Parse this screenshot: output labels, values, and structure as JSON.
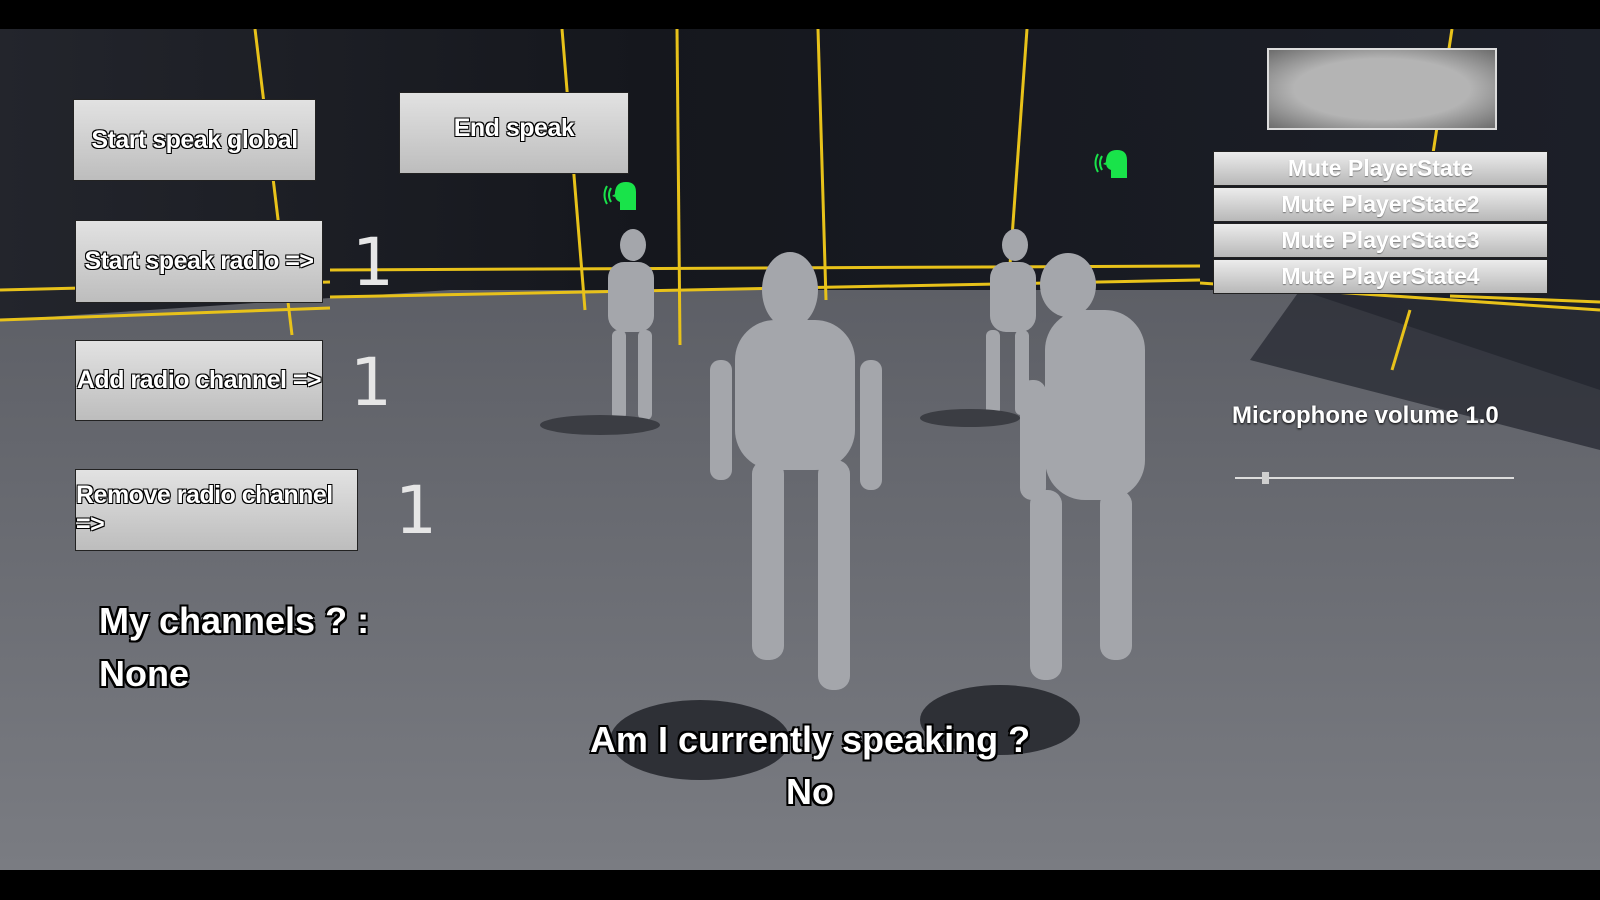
{
  "buttons": {
    "start_speak_global": "Start speak global",
    "end_speak": "End speak",
    "start_speak_radio": "Start speak radio =>",
    "add_radio_channel": "Add radio channel =>",
    "remove_radio_channel": "Remove radio channel =>"
  },
  "channel_inputs": {
    "start_speak_radio": "1",
    "add_radio_channel": "1",
    "remove_radio_channel": "1"
  },
  "my_channels": {
    "label": "My channels ? :",
    "value": "None"
  },
  "speaking_status": {
    "label": "Am I currently speaking ?",
    "value": "No"
  },
  "mute_buttons": [
    "Mute PlayerState",
    "Mute PlayerState2",
    "Mute PlayerState3",
    "Mute PlayerState4"
  ],
  "microphone": {
    "label": "Microphone volume 1.0",
    "slider_value": 0.1
  },
  "colors": {
    "speaker_icon": "#19e34a",
    "grid_lines": "#e8c21a",
    "wall": "#1a1c24",
    "floor": "#74767d"
  },
  "icons": [
    "speaking-head-icon"
  ]
}
